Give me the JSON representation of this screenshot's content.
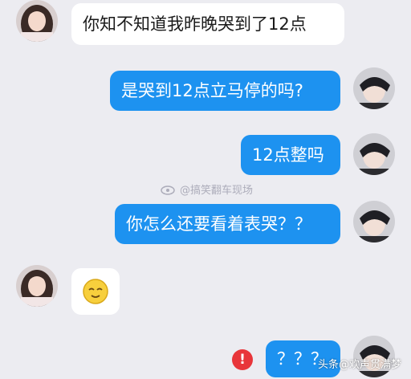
{
  "conversation": {
    "messages": [
      {
        "side": "left",
        "text": "你知不知道我昨晚哭到了12点"
      },
      {
        "side": "right",
        "text": "是哭到12点立马停的吗?"
      },
      {
        "side": "right",
        "text": "12点整吗"
      },
      {
        "side": "right",
        "text": "你怎么还要看着表哭？？"
      },
      {
        "side": "left",
        "emoji_name": "relieved-face-icon"
      },
      {
        "side": "right",
        "text": "？？？"
      }
    ]
  },
  "overlay": {
    "watermark_text": "@搞笑翻车现场",
    "credit_text": "头条@欢声贯满梦"
  },
  "colors": {
    "background": "#ececf1",
    "bubble_blue": "#1d92f0",
    "bubble_white": "#ffffff",
    "error_red": "#e8353a"
  }
}
